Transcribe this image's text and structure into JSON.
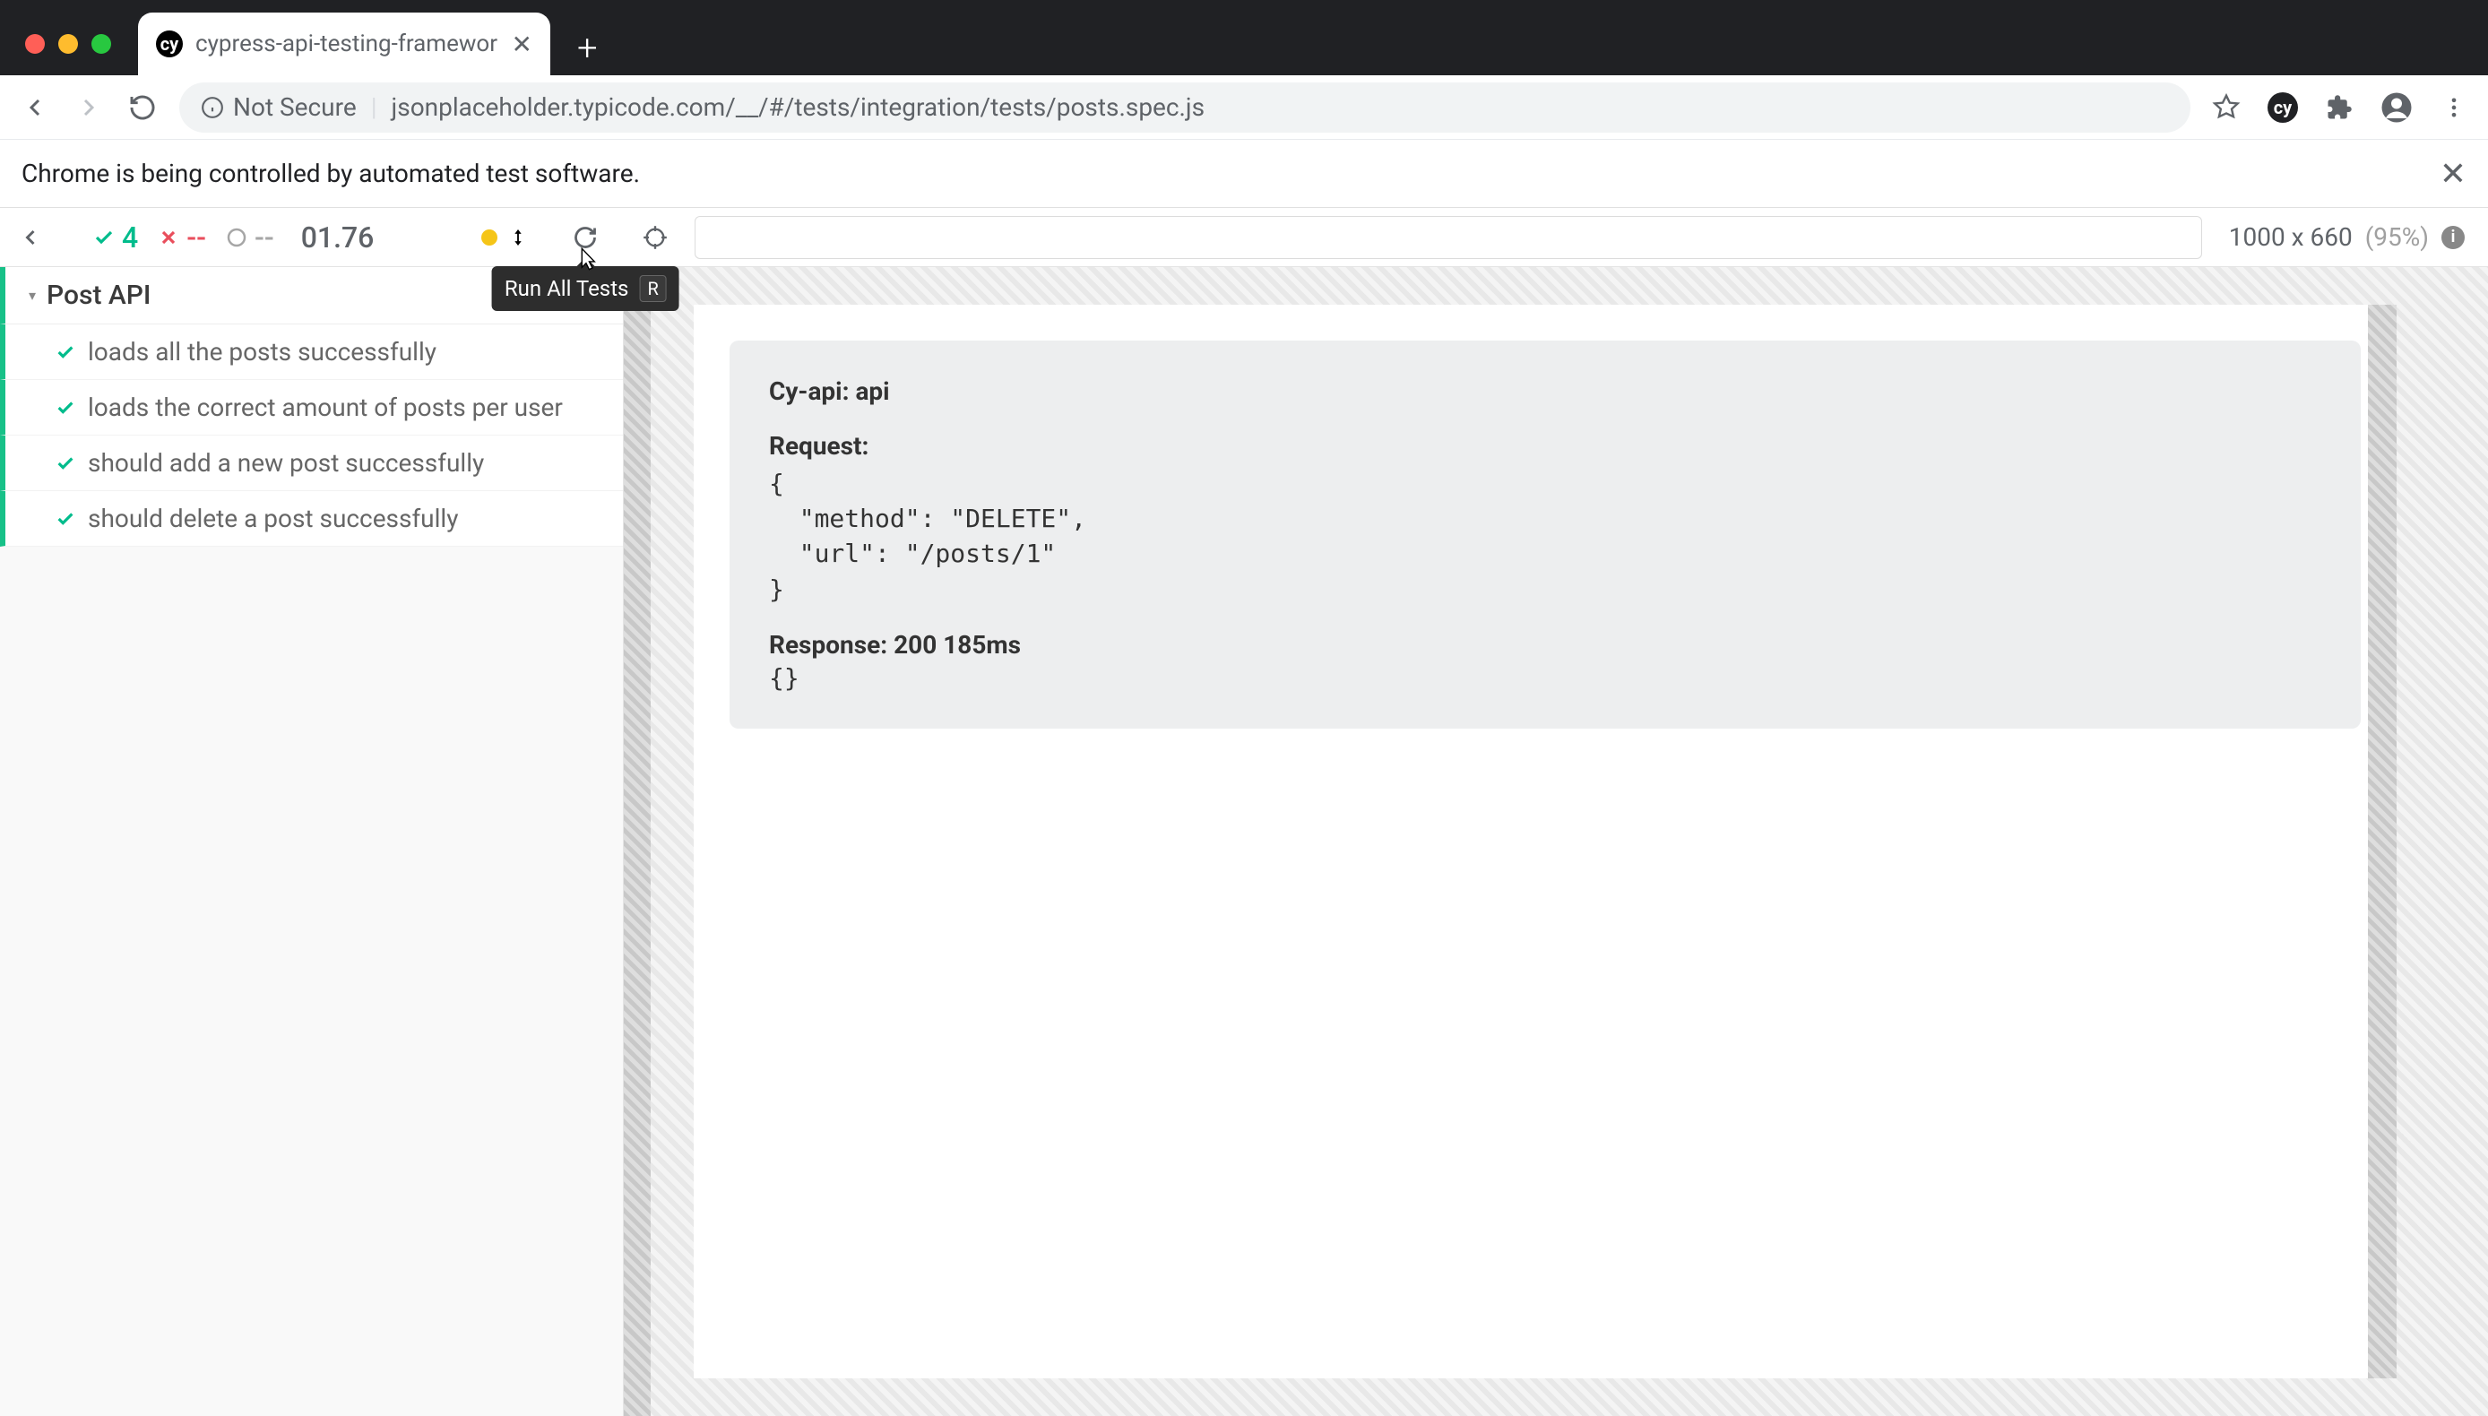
{
  "browser": {
    "tab_title": "cypress-api-testing-framewor",
    "url_label_insecure": "Not Secure",
    "url_text": "jsonplaceholder.typicode.com/__/#/tests/integration/tests/posts.spec.js"
  },
  "automation_banner": "Chrome is being controlled by automated test software.",
  "cy": {
    "pass_count": "4",
    "fail_count": "--",
    "pending_count": "--",
    "time": "01.76",
    "tooltip_text": "Run All Tests",
    "tooltip_kbd": "R",
    "viewport_dims": "1000 x 660",
    "viewport_pct": "(95%)"
  },
  "suite": {
    "title": "Post API",
    "tests": [
      "loads all the posts successfully",
      "loads the correct amount of posts per user",
      "should add a new post successfully",
      "should delete a post successfully"
    ]
  },
  "api": {
    "title": "Cy-api: api",
    "request_label": "Request:",
    "request_body": "{\n  \"method\": \"DELETE\",\n  \"url\": \"/posts/1\"\n}",
    "response_label": "Response:",
    "response_status": "200",
    "response_ms": "185ms",
    "response_body": "{}"
  }
}
